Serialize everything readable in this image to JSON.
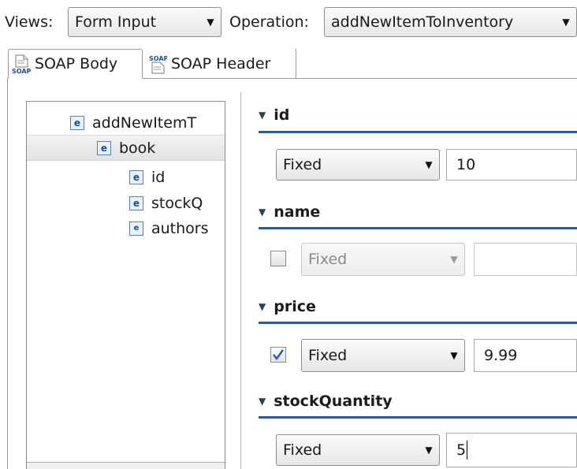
{
  "toolbar": {
    "views_label": "Views:",
    "views_value": "Form Input",
    "operation_label": "Operation:",
    "operation_value": "addNewItemToInventory"
  },
  "tabs": [
    {
      "label": "SOAP Body",
      "icon": "soap-body-icon"
    },
    {
      "label": "SOAP Header",
      "icon": "soap-header-icon"
    }
  ],
  "tree": {
    "items": [
      {
        "label": "addNewItemT",
        "icon": "element-icon",
        "level": 0
      },
      {
        "label": "book",
        "icon": "element-icon",
        "level": 1,
        "selected": true
      },
      {
        "label": "id",
        "icon": "element-icon",
        "level": 2
      },
      {
        "label": "stockQ",
        "icon": "element-icon",
        "level": 2
      },
      {
        "label": "authors",
        "icon": "element-icon",
        "level": 2
      }
    ]
  },
  "fields": {
    "id": {
      "title": "id",
      "mode": "Fixed",
      "value": "10"
    },
    "name": {
      "title": "name",
      "mode": "Fixed",
      "value": "",
      "checked": false
    },
    "price": {
      "title": "price",
      "mode": "Fixed",
      "value": "9.99",
      "checked": true
    },
    "stockQuantity": {
      "title": "stockQuantity",
      "mode": "Fixed",
      "value": "5"
    }
  },
  "icon_glyphs": {
    "element": "e",
    "soap": "SOAP"
  },
  "colors": {
    "section_rule": "#2e5c9a",
    "element_icon": "#1a4f9b",
    "check": "#2b55c5"
  }
}
